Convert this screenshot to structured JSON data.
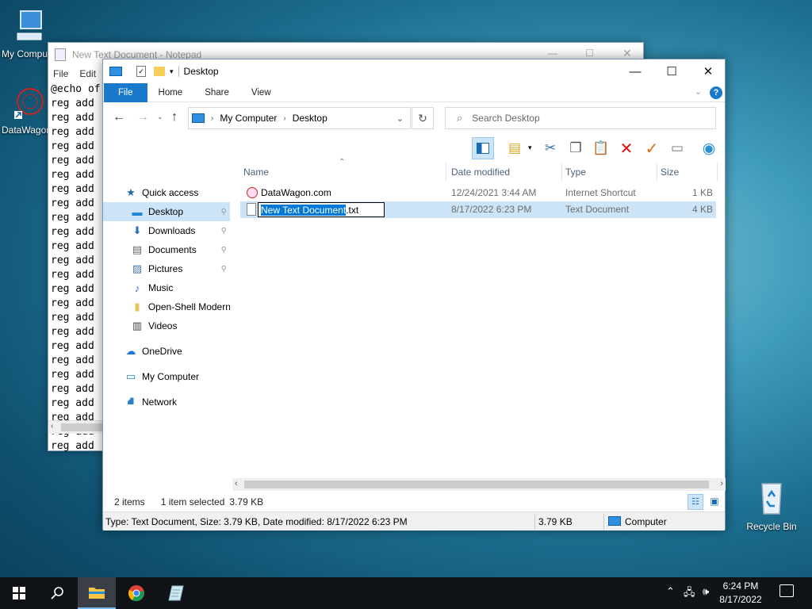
{
  "desktop": {
    "icons": [
      {
        "label": "My Computer"
      },
      {
        "label": "DataWagon.com"
      },
      {
        "label": "Recycle Bin"
      }
    ]
  },
  "notepad": {
    "title": "New Text Document - Notepad",
    "menu": [
      "File",
      "Edit"
    ],
    "lines": [
      "@echo of",
      "reg add",
      "reg add",
      "reg add",
      "reg add",
      "reg add",
      "reg add",
      "reg add",
      "reg add",
      "reg add",
      "reg add",
      "reg add",
      "reg add",
      "reg add",
      "reg add",
      "reg add",
      "reg add",
      "reg add",
      "reg add",
      "reg add",
      "reg add",
      "reg add",
      "reg add",
      "reg add",
      "reg add",
      "reg add"
    ]
  },
  "explorer": {
    "title": "Desktop",
    "ribbon_tabs": [
      "File",
      "Home",
      "Share",
      "View"
    ],
    "address": {
      "root": "My Computer",
      "current": "Desktop"
    },
    "search_placeholder": "Search Desktop",
    "nav": [
      {
        "label": "Quick access",
        "pinned": false
      },
      {
        "label": "Desktop",
        "pinned": true,
        "selected": true
      },
      {
        "label": "Downloads",
        "pinned": true
      },
      {
        "label": "Documents",
        "pinned": true
      },
      {
        "label": "Pictures",
        "pinned": true
      },
      {
        "label": "Music",
        "pinned": false
      },
      {
        "label": "Open-Shell Modern",
        "pinned": false
      },
      {
        "label": "Videos",
        "pinned": false
      },
      {
        "label": "OneDrive",
        "pinned": false
      },
      {
        "label": "My Computer",
        "pinned": false
      },
      {
        "label": "Network",
        "pinned": false
      }
    ],
    "columns": [
      "Name",
      "Date modified",
      "Type",
      "Size"
    ],
    "files": [
      {
        "name": "DataWagon.com",
        "date": "12/24/2021 3:44 AM",
        "type": "Internet Shortcut",
        "size": "1 KB"
      },
      {
        "name_selected": "New Text Document",
        "name_ext": ".txt",
        "date": "8/17/2022 6:23 PM",
        "type": "Text Document",
        "size": "4 KB"
      }
    ],
    "status": {
      "count": "2 items",
      "selected": "1 item selected",
      "selected_size": "3.79 KB",
      "details": "Type: Text Document, Size: 3.79 KB, Date modified: 8/17/2022 6:23 PM",
      "size": "3.79 KB",
      "location": "Computer"
    }
  },
  "taskbar": {
    "time": "6:24 PM",
    "date": "8/17/2022"
  },
  "colors": {
    "accent": "#1979ca",
    "selection": "#cce4f7",
    "taskbar": "#101418"
  }
}
